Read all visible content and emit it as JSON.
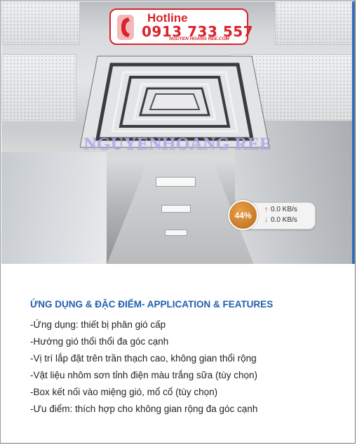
{
  "hotline": {
    "title": "Hotline",
    "number": "0913 733 557",
    "website": "NGUYEN HOANG REE.COM"
  },
  "watermark": "NGUYENHOANG REE",
  "network_widget": {
    "percent": "44%",
    "upload": "0.0 KB/s",
    "download": "0.0 KB/s",
    "badge_color": "#c97a22"
  },
  "section": {
    "heading": "ỨNG DỤNG & ĐẶC ĐIỂM- APPLICATION & FEATURES",
    "heading_color": "#1f5fae",
    "items": [
      "-Ứng dụng: thiết bị phân gió cấp",
      "-Hướng gió thổi thổi đa góc cạnh",
      "-Vị trí  lắp đặt trên trần thạch cao, không gian thổi rộng",
      "-Vật liệu nhôm sơn tỉnh điện màu trắng sữa (tùy chọn)",
      "-Box kết nối vào miệng gió, mổ cổ (tùy chọn)",
      "-Ưu điểm: thích hợp cho không gian rộng đa góc cạnh"
    ]
  }
}
